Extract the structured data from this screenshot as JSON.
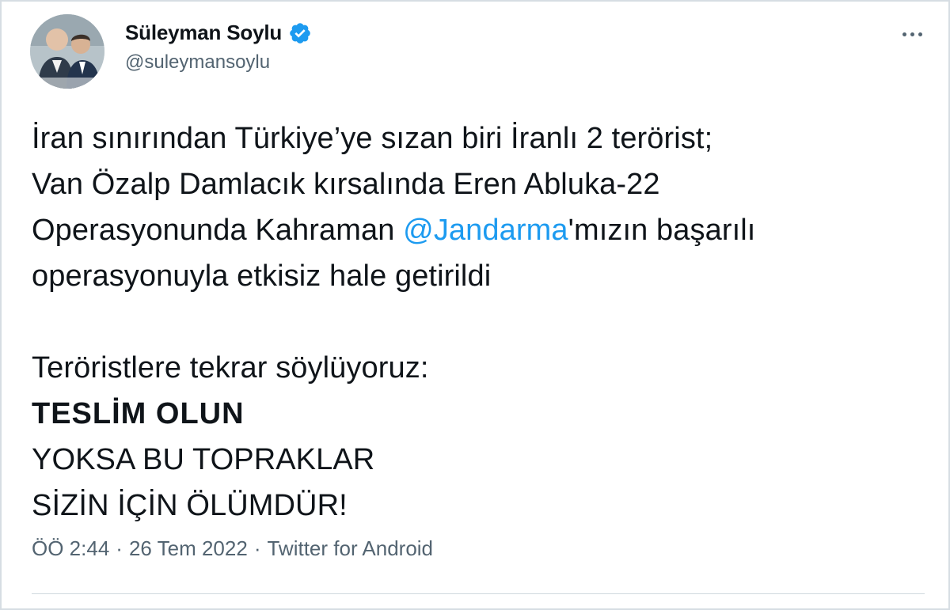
{
  "author": {
    "display_name": "Süleyman Soylu",
    "handle": "@suleymansoylu",
    "verified_icon": "verified-badge-icon",
    "avatar_icon": "profile-photo"
  },
  "menu": {
    "more_icon": "more-options-icon"
  },
  "tweet": {
    "line1": "İran sınırından Türkiye’ye sızan biri İranlı 2 terörist;",
    "line2": "Van Özalp Damlacık kırsalında Eren Abluka-22",
    "line3_prefix": "Operasyonunda Kahraman ",
    "mention": "@Jandarma",
    "line3_suffix": "'mızın başarılı",
    "line4": "operasyonuyla etkisiz hale getirildi",
    "line5": "Teröristlere tekrar söylüyoruz:",
    "line6": "TESLİM OLUN",
    "line7": "YOKSA BU TOPRAKLAR",
    "line8": "SİZİN İÇİN ÖLÜMDÜR!"
  },
  "meta": {
    "time": "ÖÖ 2:44",
    "separator": "·",
    "date": "26 Tem 2022",
    "source": "Twitter for Android"
  },
  "colors": {
    "link": "#1d9bf0",
    "secondary_text": "#536471",
    "primary_text": "#0f1419",
    "border": "#cfd9de"
  }
}
